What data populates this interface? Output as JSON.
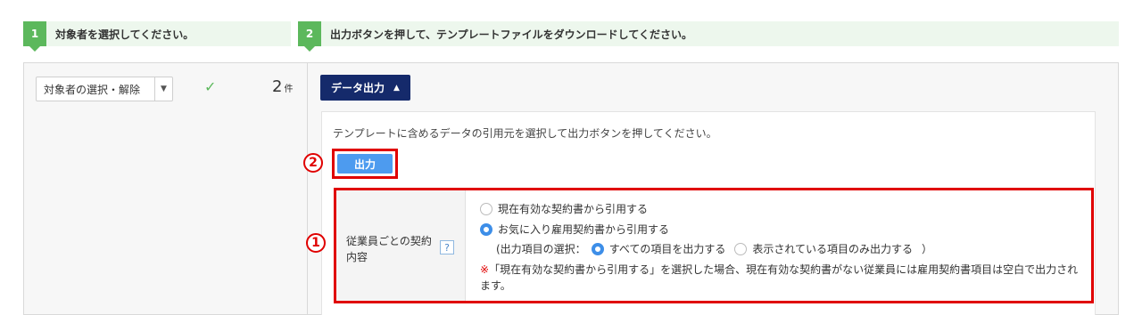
{
  "steps": [
    {
      "num": "1",
      "text": "対象者を選択してください。"
    },
    {
      "num": "2",
      "text": "出力ボタンを押して、テンプレートファイルをダウンロードしてください。"
    }
  ],
  "left": {
    "select_label": "対象者の選択・解除",
    "check": "✓",
    "count": "2",
    "count_unit": "件"
  },
  "right": {
    "data_button": "データ出力",
    "data_button_arrow": "▲",
    "description": "テンプレートに含めるデータの引用元を選択して出力ボタンを押してください。",
    "output_button": "出力",
    "marker_output": "2",
    "marker_options": "1",
    "option": {
      "label": "従業員ごとの契約内容",
      "help": "?",
      "choice1": "現在有効な契約書から引用する",
      "choice2": "お気に入り雇用契約書から引用する",
      "sub_prefix": "(出力項目の選択：",
      "sub_choice1": "すべての項目を出力する",
      "sub_choice2": "表示されている項目のみ出力する",
      "sub_suffix": "）",
      "note_mark": "※",
      "note": "「現在有効な契約書から引用する」を選択した場合、現在有効な契約書がない従業員には雇用契約書項目は空白で出力されます。"
    }
  }
}
